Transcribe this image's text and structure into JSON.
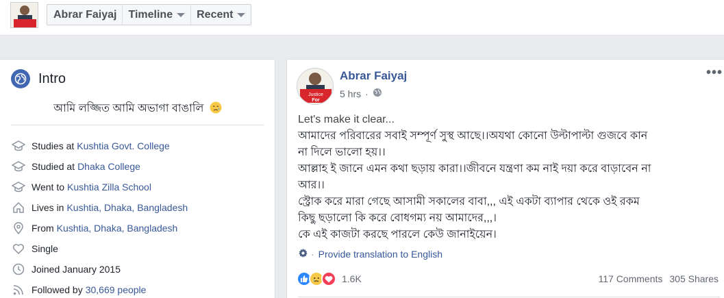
{
  "topbar": {
    "profile_name": "Abrar Faiyaj",
    "timeline_label": "Timeline",
    "recent_label": "Recent",
    "avatar_text_1": "Justice",
    "avatar_text_2": "For"
  },
  "intro": {
    "title": "Intro",
    "bio": "আমি লজ্জিত আমি অভাগা বাঙালি",
    "items": [
      {
        "icon": "graduation-cap-icon",
        "prefix": "Studies at",
        "link": "Kushtia Govt. College"
      },
      {
        "icon": "graduation-cap-icon",
        "prefix": "Studied at",
        "link": "Dhaka College"
      },
      {
        "icon": "graduation-cap-icon",
        "prefix": "Went to",
        "link": "Kushtia Zilla School"
      },
      {
        "icon": "home-icon",
        "prefix": "Lives in",
        "link": "Kushtia, Dhaka, Bangladesh"
      },
      {
        "icon": "location-pin-icon",
        "prefix": "From",
        "link": "Kushtia, Dhaka, Bangladesh"
      },
      {
        "icon": "heart-icon",
        "prefix": "Single",
        "link": ""
      },
      {
        "icon": "clock-icon",
        "prefix": "Joined January 2015",
        "link": ""
      },
      {
        "icon": "rss-icon",
        "prefix": "Followed by",
        "link": "30,669 people"
      }
    ]
  },
  "post": {
    "author": "Abrar Faiyaj",
    "time": "5 hrs",
    "lines": [
      "Let's make it clear...",
      "আমাদের পরিবারের সবাই সম্পূর্ণ সুস্থ আছে।।অযথা কোনো উল্টাপাল্টা গুজবে কান",
      "না দিলে ভালো হয়।।",
      "আল্লাহ ই জানে এমন কথা ছড়ায় কারা।।জীবনে যন্ত্রণা কম নাই দয়া করে বাড়াবেন না",
      "আর।।",
      "স্ট্রোক করে মারা গেছে আসামী সকালের বাবা,,, এই একটা ব্যাপার থেকে ওই রকম",
      "কিছু ছড়ালো কি করে বোধগম্য নয় আমাদের,,,।",
      "কে এই কাজটা করছে পারলে কেউ জানাইয়েন।"
    ],
    "translate_label": "Provide translation to English",
    "reaction_count": "1.6K",
    "comments": "117 Comments",
    "shares": "305 Shares"
  },
  "colors": {
    "link": "#385898",
    "brand": "#4267b2",
    "background": "#e9ebee"
  }
}
